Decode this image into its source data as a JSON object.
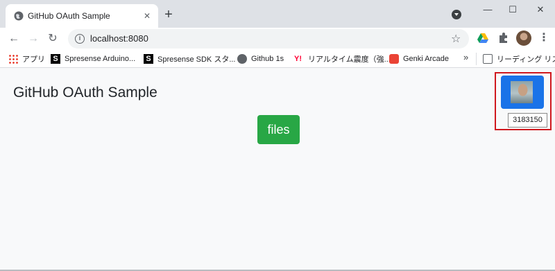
{
  "browser": {
    "tab": {
      "title": "GitHub OAuth Sample",
      "close_glyph": "✕"
    },
    "new_tab_glyph": "+",
    "window_controls": {
      "minimize": "—",
      "maximize": "☐",
      "close": "✕"
    },
    "nav": {
      "back": "←",
      "forward": "→",
      "reload": "↻"
    },
    "address": {
      "url": "localhost:8080",
      "info_glyph": "i",
      "star_glyph": "☆"
    },
    "menu_glyph": "⋮",
    "icons": [
      "page-favicon-icon",
      "tab-search-icon",
      "info-icon",
      "star-icon",
      "google-drive-icon",
      "puzzle-extension-icon",
      "profile-avatar-icon",
      "menu-icon"
    ]
  },
  "bookmarks": {
    "items": [
      {
        "label": "アプリ",
        "icon": "apps-grid-icon"
      },
      {
        "label": "Spresense Arduino...",
        "icon": "spresense-icon"
      },
      {
        "label": "Spresense SDK スタ...",
        "icon": "spresense-icon"
      },
      {
        "label": "Github 1s",
        "icon": "globe-icon"
      },
      {
        "label": "リアルタイム震度（強...",
        "icon": "yahoo-icon"
      },
      {
        "label": "Genki Arcade",
        "icon": "genki-arcade-icon"
      }
    ],
    "more_glyph": "»",
    "reading_list": {
      "label": "リーディング リスト",
      "icon": "reading-list-icon"
    }
  },
  "page": {
    "title": "GitHub OAuth Sample",
    "files_button": "files",
    "user": {
      "id": "3183150",
      "avatar_icon": "user-avatar-icon"
    }
  },
  "colors": {
    "files_button": "#28a745",
    "user_card": "#1a73e8",
    "highlight_border": "#d0181e",
    "page_background": "#f8f9fa"
  }
}
